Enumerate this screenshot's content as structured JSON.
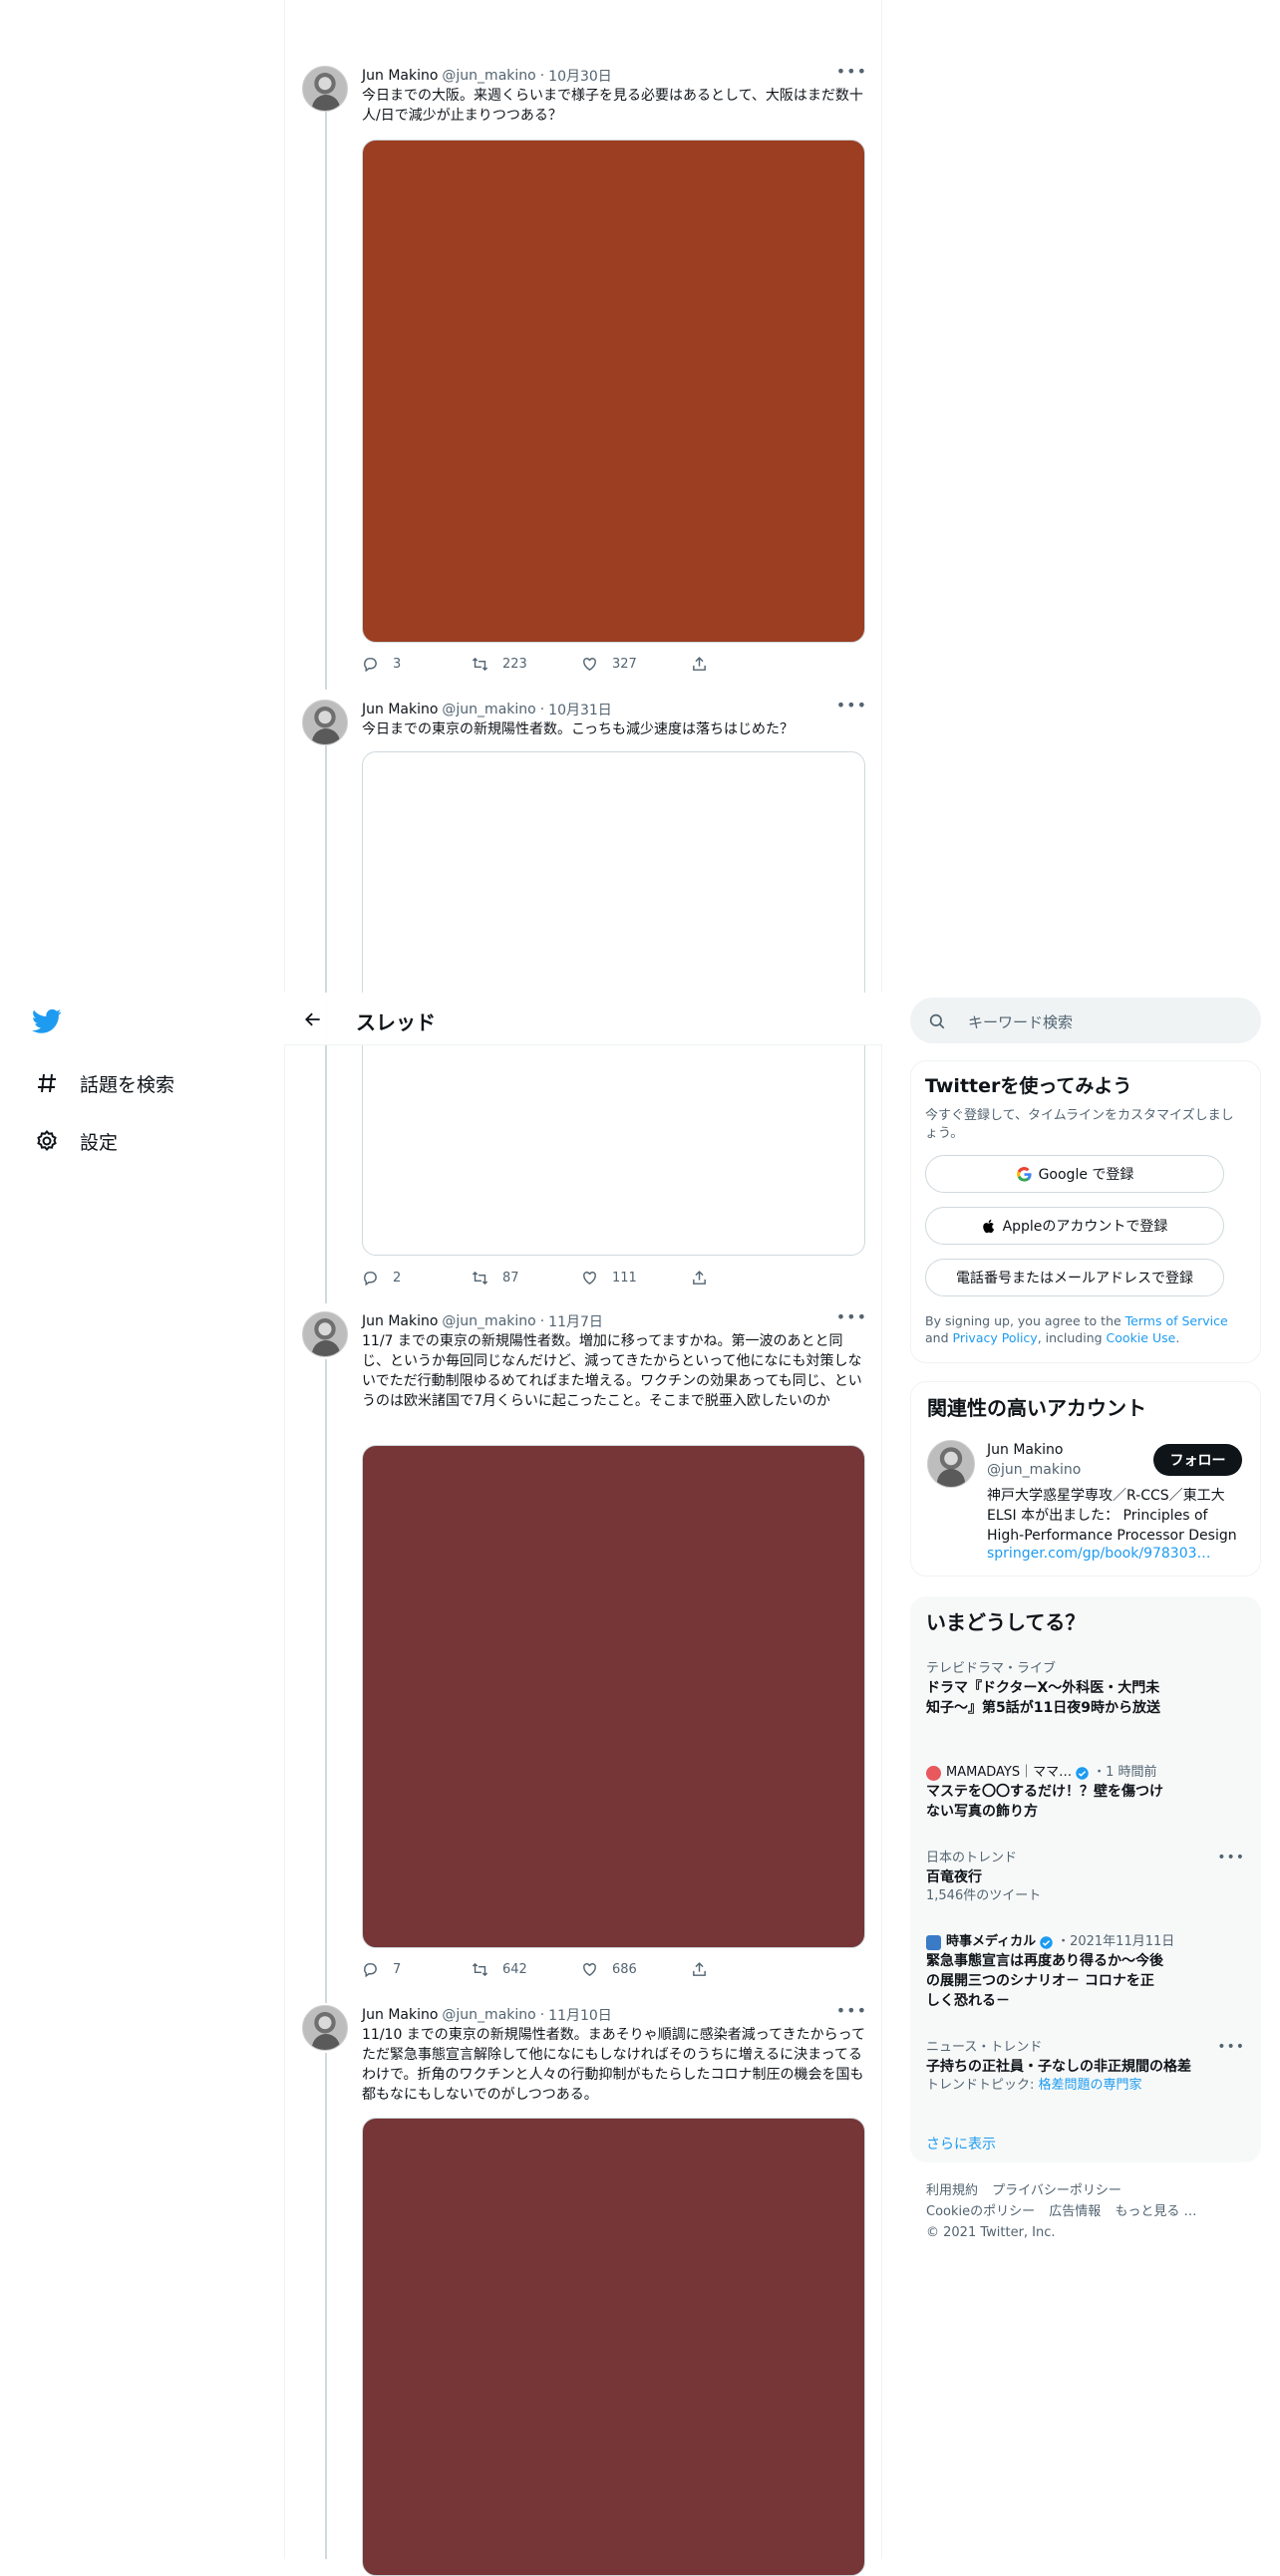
{
  "nav": {
    "logo_icon": "twitter-bird-icon",
    "items": [
      {
        "label": "話題を検索",
        "icon": "hashtag-icon"
      },
      {
        "label": "設定",
        "icon": "gear-icon"
      }
    ]
  },
  "header": {
    "title": "スレッド",
    "back_icon": "arrow-left-icon"
  },
  "tweets": [
    {
      "name": "Jun Makino",
      "handle": "@jun_makino",
      "date": "10月30日",
      "text": "今日までの大阪。来週くらいまで様子を見る必要はあるとして、大阪はまだ数十人/日で減少が止まりつつある？",
      "media_color": "#9b3e22",
      "replies": "3",
      "retweets": "223",
      "likes": "327"
    },
    {
      "name": "Jun Makino",
      "handle": "@jun_makino",
      "date": "10月31日",
      "text": "今日までの東京の新規陽性者数。こっちも減少速度は落ちはじめた？",
      "media_color": "#ffffff",
      "replies": "2",
      "retweets": "87",
      "likes": "111"
    },
    {
      "name": "Jun Makino",
      "handle": "@jun_makino",
      "date": "11月7日",
      "text": "11/7 までの東京の新規陽性者数。増加に移ってますかね。第一波のあとと同じ、というか毎回同じなんだけど、減ってきたからといって他になにも対策しないでただ行動制限ゆるめてればまた増える。ワクチンの効果あっても同じ、というのは欧米諸国で7月くらいに起こったこと。そこまで脱亜入欧したいのか",
      "media_color": "#763637",
      "replies": "7",
      "retweets": "642",
      "likes": "686"
    },
    {
      "name": "Jun Makino",
      "handle": "@jun_makino",
      "date": "11月10日",
      "text": "11/10 までの東京の新規陽性者数。まあそりゃ順調に感染者減ってきたからってただ緊急事態宣言解除して他になにもしなければそのうちに増えるに決まってるわけで。折角のワクチンと人々の行動抑制がもたらしたコロナ制圧の機会を国も都もなにもしないでのがしつつある。",
      "media_color": "#763637"
    }
  ],
  "search": {
    "placeholder": "キーワード検索"
  },
  "signup": {
    "title": "Twitterを使ってみよう",
    "subtitle": "今すぐ登録して、タイムラインをカスタマイズしましょう。",
    "google": "Google で登録",
    "apple": "Appleのアカウントで登録",
    "phone": "電話番号またはメールアドレスで登録",
    "terms_prefix": "By signing up, you agree to the ",
    "terms_link": "Terms of Service",
    "terms_and": " and ",
    "privacy_link": "Privacy Policy",
    "terms_including": ", including ",
    "cookie_link": "Cookie Use",
    "terms_end": "."
  },
  "related": {
    "title": "関連性の高いアカウント",
    "name": "Jun Makino",
    "handle": "@jun_makino",
    "follow": "フォロー",
    "bio": "神戸大学惑星学専攻／R-CCS／東工大ELSI 本が出ました： Principles of High-Performance Processor Design",
    "link": "springer.com/gp/book/978303…"
  },
  "trends": {
    "title": "いまどうしてる？",
    "items": [
      {
        "meta": "テレビドラマ・ライブ",
        "title": "ドラマ『ドクターX～外科医・大門未知子～』第5話が11日夜9時から放送"
      },
      {
        "meta_account": "MAMADAYS｜ママ…",
        "meta_time": "・1 時間前",
        "title": "マステを〇〇するだけ！？壁を傷つけない写真の飾り方"
      },
      {
        "meta": "日本のトレンド",
        "title": "百竜夜行",
        "sub": "1,546件のツイート"
      },
      {
        "meta_account": "時事メディカル",
        "meta_time": "・2021年11月11日",
        "title": "緊急事態宣言は再度あり得るか～今後の展開三つのシナリオ－ コロナを正しく恐れる－"
      },
      {
        "meta": "ニュース・トレンド",
        "title": "子持ちの正社員・子なしの非正規間の格差",
        "sub_prefix": "トレンドトピック: ",
        "sub_link": "格差問題の専門家"
      }
    ],
    "show_more": "さらに表示"
  },
  "footer": {
    "links": [
      "利用規約",
      "プライバシーポリシー",
      "Cookieのポリシー",
      "広告情報",
      "もっと見る …"
    ],
    "copyright": "© 2021 Twitter, Inc."
  },
  "colors": {
    "accent": "#1d9bf0",
    "text": "#0f1419",
    "muted": "#536471"
  }
}
